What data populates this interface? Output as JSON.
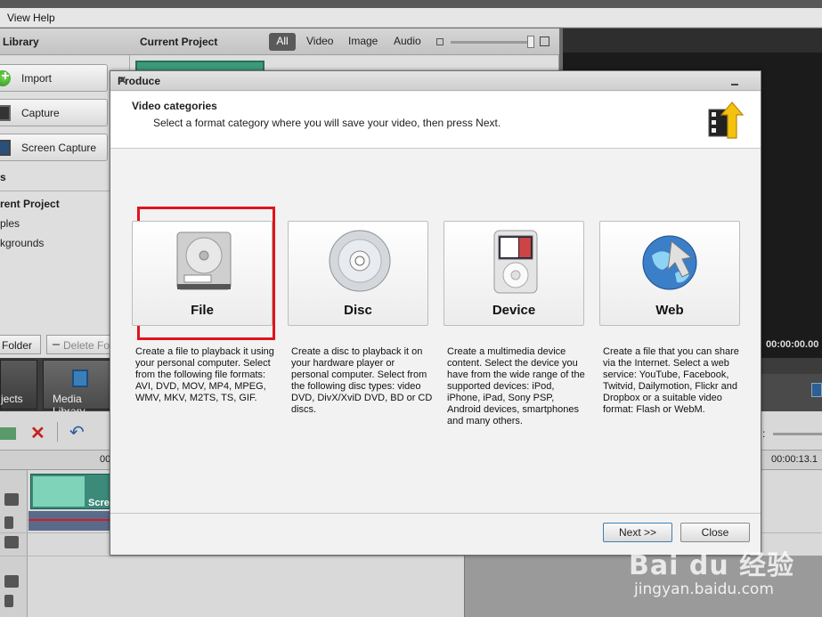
{
  "menu": {
    "view": "View",
    "help": "Help"
  },
  "library": {
    "title": "Library",
    "import": "Import",
    "capture": "Capture",
    "screen_capture": "Screen Capture",
    "section_s": "s",
    "project_title": "rent Project",
    "items": [
      "ples",
      "kgrounds"
    ],
    "folder_btn": "Folder",
    "delete_btn": "Delete Fold"
  },
  "current_project": {
    "title": "Current Project",
    "filters": [
      "All",
      "Video",
      "Image",
      "Audio"
    ]
  },
  "preview": {
    "time": "00:00:00.00"
  },
  "tabs": {
    "projects": "jects",
    "media_library": "Media Library"
  },
  "ruler": {
    "left": "00",
    "right": "00:00:13.1"
  },
  "timeline": {
    "clip_label": "Scre"
  },
  "dialog": {
    "title": "Produce",
    "header": "Video categories",
    "subtitle": "Select a format category where you will save your video, then press Next.",
    "categories": [
      {
        "label": "File",
        "icon": "hard-drive-icon",
        "desc": "Create a file to playback it using your personal computer. Select from the following file formats: AVI, DVD, MOV, MP4, MPEG, WMV, MKV, M2TS, TS, GIF."
      },
      {
        "label": "Disc",
        "icon": "disc-icon",
        "desc": "Create a disc to playback it on your hardware player or personal computer. Select from the following disc types: video DVD, DivX/XviD DVD, BD or CD discs."
      },
      {
        "label": "Device",
        "icon": "ipod-icon",
        "desc": "Create a multimedia device content. Select the device you have from the wide range of the supported devices: iPod, iPhone, iPad, Sony PSP, Android devices, smartphones and many others."
      },
      {
        "label": "Web",
        "icon": "globe-icon",
        "desc": "Create a file that you can share via the Internet. Select a web service: YouTube, Facebook, Twitvid, Dailymotion, Flickr and Dropbox or a suitable video format: Flash or WebM."
      }
    ],
    "next_btn": "Next >>",
    "close_btn": "Close",
    "highlight_color": "#e0141e"
  },
  "watermark": {
    "brand": "Bai du 经验",
    "url": "jingyan.baidu.com"
  }
}
